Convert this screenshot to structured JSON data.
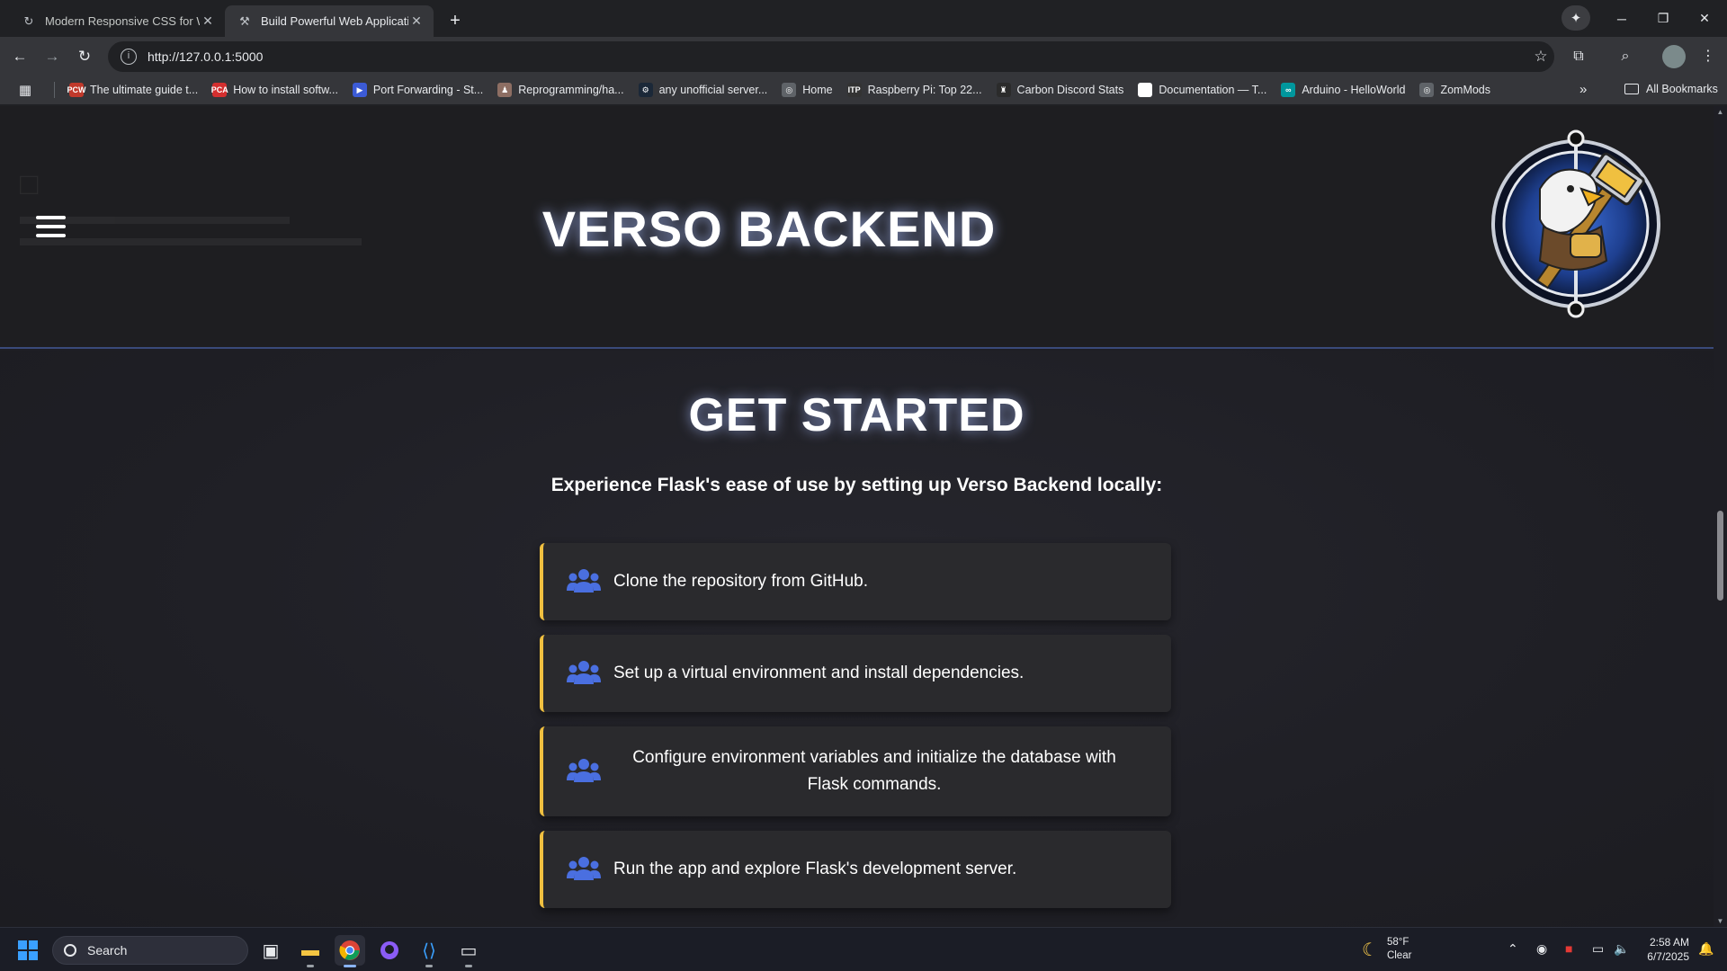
{
  "browser": {
    "tabs": [
      {
        "title": "Modern Responsive CSS for We",
        "active": false
      },
      {
        "title": "Build Powerful Web Application",
        "active": true
      }
    ],
    "url": "http://127.0.0.1:5000",
    "bookmarks": [
      {
        "label": "The ultimate guide t...",
        "icon": "pcw-icon",
        "color": "#c0392b",
        "badge": "PCW"
      },
      {
        "label": "How to install softw...",
        "icon": "pcgamer-icon",
        "color": "#d32f2f",
        "badge": "PCA"
      },
      {
        "label": "Port Forwarding - St...",
        "icon": "portforward-icon",
        "color": "#3c5bd6",
        "badge": "▶"
      },
      {
        "label": "Reprogramming/ha...",
        "icon": "person-icon",
        "color": "#8d6e63",
        "badge": "♟"
      },
      {
        "label": "any unofficial server...",
        "icon": "steam-icon",
        "color": "#1b2838",
        "badge": "⚙"
      },
      {
        "label": "Home",
        "icon": "globe-icon",
        "color": "#5f6368",
        "badge": "◎"
      },
      {
        "label": "Raspberry Pi: Top 22...",
        "icon": "itp-icon",
        "color": "#333333",
        "badge": "ITP"
      },
      {
        "label": "Carbon Discord Stats",
        "icon": "carbon-icon",
        "color": "#2b2b2b",
        "badge": "♜"
      },
      {
        "label": "Documentation — T...",
        "icon": "doc-icon",
        "color": "#ffffff",
        "badge": ""
      },
      {
        "label": "Arduino - HelloWorld",
        "icon": "arduino-icon",
        "color": "#00979d",
        "badge": "∞"
      },
      {
        "label": "ZomMods",
        "icon": "globe-icon",
        "color": "#5f6368",
        "badge": "◎"
      }
    ],
    "all_bookmarks": "All Bookmarks"
  },
  "page": {
    "site_title": "VERSO BACKEND",
    "section_title": "GET STARTED",
    "section_intro": "Experience Flask's ease of use by setting up Verso Backend locally:",
    "steps": [
      "Clone the repository from GitHub.",
      "Set up a virtual environment and install dependencies.",
      "Configure environment variables and initialize the database with Flask commands.",
      "Run the app and explore Flask's development server."
    ],
    "accent_color": "#f0c040",
    "icon_color": "#4a6fe0"
  },
  "taskbar": {
    "search_placeholder": "Search",
    "weather_temp": "58°F",
    "weather_desc": "Clear",
    "time": "2:58 AM",
    "date": "6/7/2025"
  }
}
